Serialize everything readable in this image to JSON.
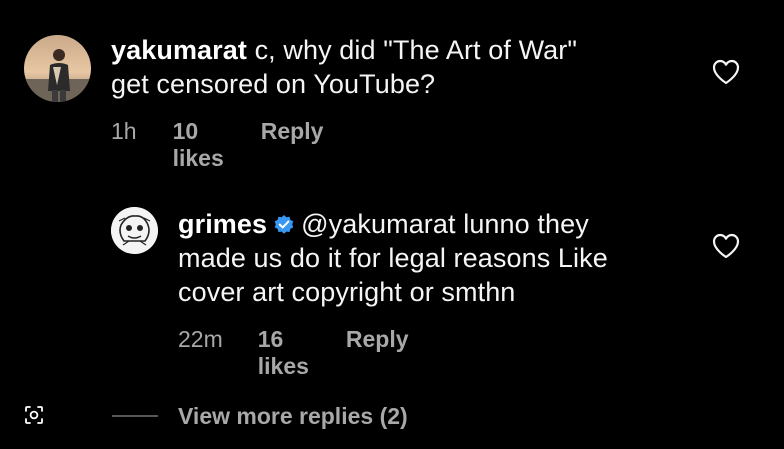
{
  "comments": [
    {
      "username": "yakumarat",
      "text_line1": " c, why did \"The Art of War\"",
      "text_line2": "get censored on YouTube?",
      "time": "1h",
      "likes": "10 likes",
      "reply": "Reply"
    },
    {
      "username": "grimes",
      "verified": true,
      "text_line1": "@yakumarat lunno they",
      "text_line2": "made us do it for legal reasons Like",
      "text_line3": "cover art copyright or smthn",
      "time": "22m",
      "likes": "16 likes",
      "reply": "Reply"
    }
  ],
  "view_more": "View more replies (2)",
  "colors": {
    "background": "#000000",
    "text": "#f5f5f5",
    "meta": "#a8a8a8",
    "verified": "#3897f0"
  },
  "icons": [
    "heart-icon",
    "verified-badge-icon",
    "scan-icon"
  ]
}
